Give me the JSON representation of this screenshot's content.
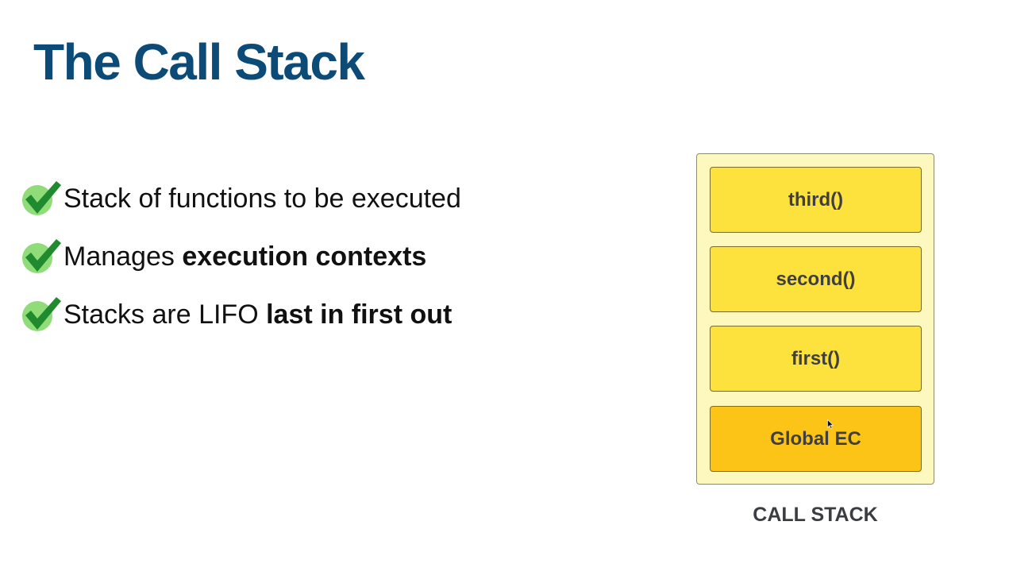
{
  "slide": {
    "title": "The Call Stack"
  },
  "bullets": [
    {
      "text": "Stack of functions to be executed",
      "bold": ""
    },
    {
      "text": "Manages ",
      "bold": "execution contexts"
    },
    {
      "text": "Stacks are LIFO ",
      "bold": "last in first out"
    }
  ],
  "call_stack": {
    "frames": [
      "third()",
      "second()",
      "first()",
      "Global EC"
    ],
    "caption": "CALL STACK"
  },
  "icons": {
    "bullet_icon": "check-icon",
    "pointer": "mouse-cursor-icon"
  },
  "colors": {
    "title": "#0c4a78",
    "check": "#1f8a2e",
    "check_circle": "#8fdc78",
    "stack_bg": "#fdf8bd",
    "frame": "#fde13d",
    "global_frame": "#fbc417"
  }
}
